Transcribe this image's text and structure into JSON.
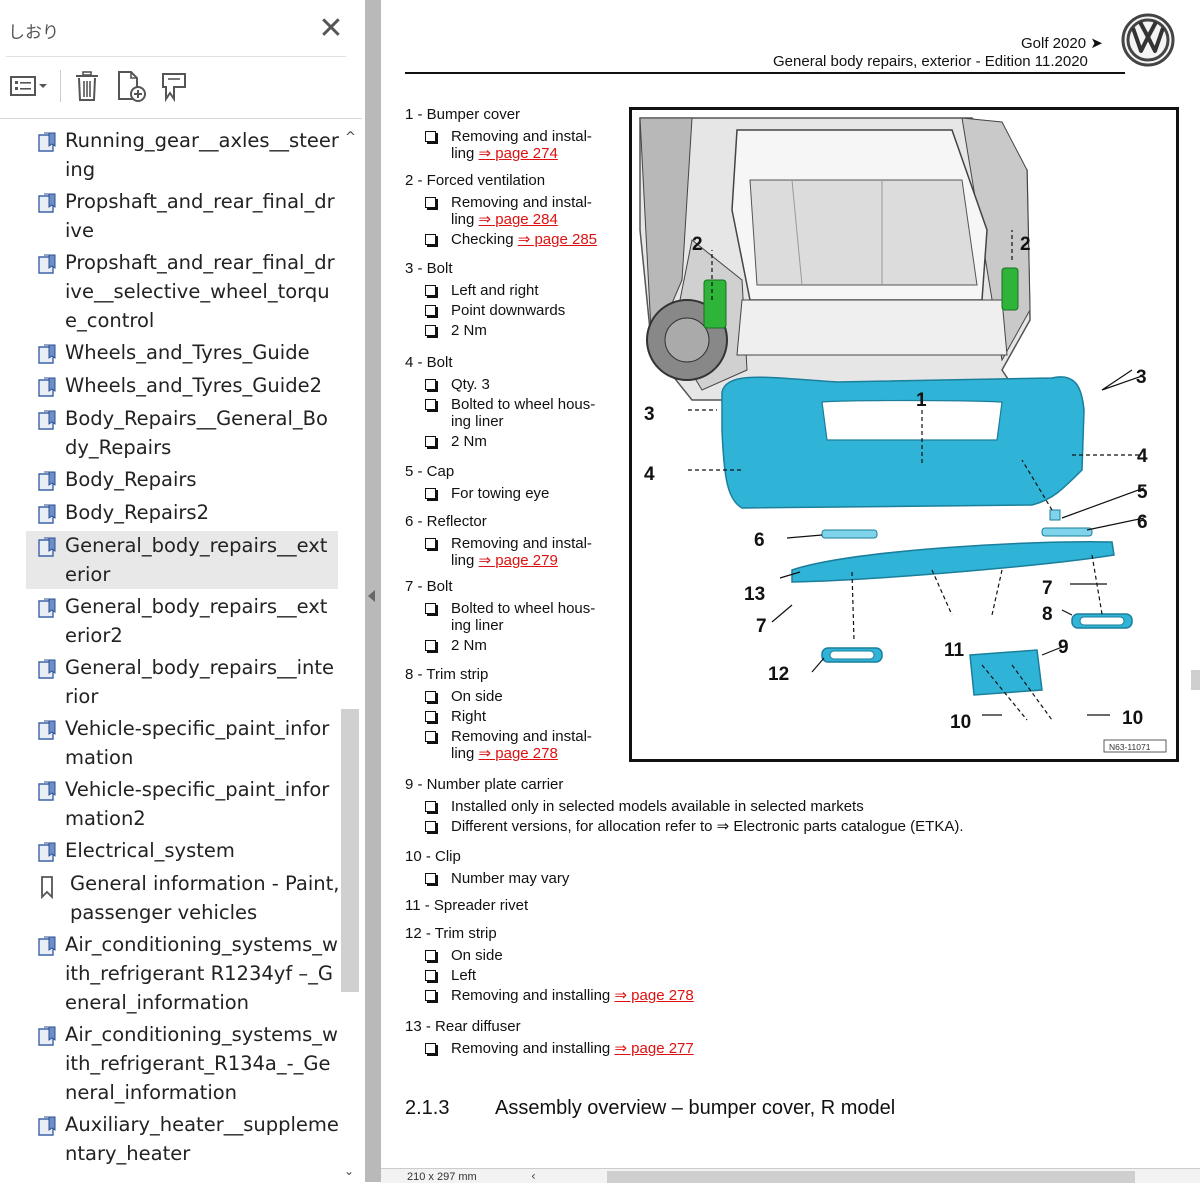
{
  "sidebar": {
    "title": "しおり",
    "toolbar": [
      "options-menu",
      "delete-bookmark",
      "add-bookmark",
      "expand-bookmark"
    ],
    "items": [
      {
        "label": "Running_gear__axles__steering",
        "icon": "bookmark-page-icon"
      },
      {
        "label": "Propshaft_and_rear_final_drive",
        "icon": "bookmark-page-icon"
      },
      {
        "label": "Propshaft_and_rear_final_drive__selective_wheel_torque_control",
        "icon": "bookmark-page-icon"
      },
      {
        "label": "Wheels_and_Tyres_Guide",
        "icon": "bookmark-page-icon"
      },
      {
        "label": "Wheels_and_Tyres_Guide2",
        "icon": "bookmark-page-icon"
      },
      {
        "label": "Body_Repairs__General_Body_Repairs",
        "icon": "bookmark-page-icon"
      },
      {
        "label": "Body_Repairs",
        "icon": "bookmark-page-icon"
      },
      {
        "label": "Body_Repairs2",
        "icon": "bookmark-page-icon"
      },
      {
        "label": "General_body_repairs__exterior",
        "icon": "bookmark-page-icon",
        "selected": true
      },
      {
        "label": "General_body_repairs__exterior2",
        "icon": "bookmark-page-icon"
      },
      {
        "label": "General_body_repairs__interior",
        "icon": "bookmark-page-icon"
      },
      {
        "label": "Vehicle-specific_paint_information",
        "icon": "bookmark-page-icon"
      },
      {
        "label": "Vehicle-specific_paint_information2",
        "icon": "bookmark-page-icon"
      },
      {
        "label": "Electrical_system",
        "icon": "bookmark-page-icon"
      },
      {
        "label": "General information - Paint, passenger vehicles",
        "icon": "bookmark-ribbon-icon"
      },
      {
        "label": "Air_conditioning_systems_with_refrigerant R1234yf –_General_information",
        "icon": "bookmark-page-icon"
      },
      {
        "label": "Air_conditioning_systems_with_refrigerant_R134a_-_General_information",
        "icon": "bookmark-page-icon"
      },
      {
        "label": "Auxiliary_heater__supplementary_heater",
        "icon": "bookmark-page-icon"
      }
    ]
  },
  "doc": {
    "model": "Golf 2020 ➤",
    "subtitle": "General body repairs, exterior - Edition 11.2020",
    "items": [
      {
        "h": "1 - Bumper cover",
        "subs": [
          {
            "t": "Removing and instal-",
            "t2": "ling ",
            "link": "⇒ page 274"
          }
        ]
      },
      {
        "h": "2 - Forced ventilation",
        "subs": [
          {
            "t": "Removing and instal-",
            "t2": "ling ",
            "link": "⇒ page 284"
          },
          {
            "t": "Checking ",
            "link": "⇒ page 285"
          }
        ]
      },
      {
        "h": "3 - Bolt",
        "subs": [
          {
            "t": "Left and right"
          },
          {
            "t": "Point downwards"
          },
          {
            "t": "2 Nm"
          }
        ]
      },
      {
        "h": "4 - Bolt",
        "subs": [
          {
            "t": "Qty. 3"
          },
          {
            "t": "Bolted to wheel hous-",
            "t2": "ing liner"
          },
          {
            "t": "2 Nm"
          }
        ]
      },
      {
        "h": "5 - Cap",
        "subs": [
          {
            "t": "For towing eye"
          }
        ]
      },
      {
        "h": "6 - Reflector",
        "subs": [
          {
            "t": "Removing and instal-",
            "t2": "ling ",
            "link": "⇒ page 279"
          }
        ]
      },
      {
        "h": "7 - Bolt",
        "subs": [
          {
            "t": "Bolted to wheel hous-",
            "t2": "ing liner"
          },
          {
            "t": "2 Nm"
          }
        ]
      },
      {
        "h": "8 - Trim strip",
        "subs": [
          {
            "t": "On side"
          },
          {
            "t": "Right"
          },
          {
            "t": "Removing and instal-",
            "t2": "ling ",
            "link": "⇒ page 278"
          }
        ]
      },
      {
        "h": "9 - Number plate carrier",
        "subs": [
          {
            "t": "Installed only in selected models available in selected markets"
          },
          {
            "t": "Different versions, for allocation refer to ⇒ Electronic parts catalogue (ETKA)."
          }
        ]
      },
      {
        "h": "10 - Clip",
        "subs": [
          {
            "t": "Number may vary"
          }
        ]
      },
      {
        "h": "11 - Spreader rivet",
        "subs": []
      },
      {
        "h": "12 - Trim strip",
        "subs": [
          {
            "t": "On side"
          },
          {
            "t": "Left"
          },
          {
            "t": "Removing and installing ",
            "link": "⇒ page 278"
          }
        ]
      },
      {
        "h": "13 - Rear diffuser",
        "subs": [
          {
            "t": "Removing and installing ",
            "link": "⇒ page 277"
          }
        ]
      }
    ],
    "figure": {
      "ref": "N63-11071",
      "callouts": [
        "1",
        "2",
        "2",
        "3",
        "3",
        "4",
        "4",
        "5",
        "6",
        "6",
        "7",
        "7",
        "8",
        "9",
        "10",
        "10",
        "11",
        "12",
        "13"
      ]
    },
    "section_number": "2.1.3",
    "section_title": "Assembly overview – bumper cover, R model",
    "page_size": "210 x 297 mm"
  },
  "colors": {
    "part_blue": "#2fb4d8",
    "link_red": "#d11111",
    "vent_green": "#2fb43a"
  }
}
